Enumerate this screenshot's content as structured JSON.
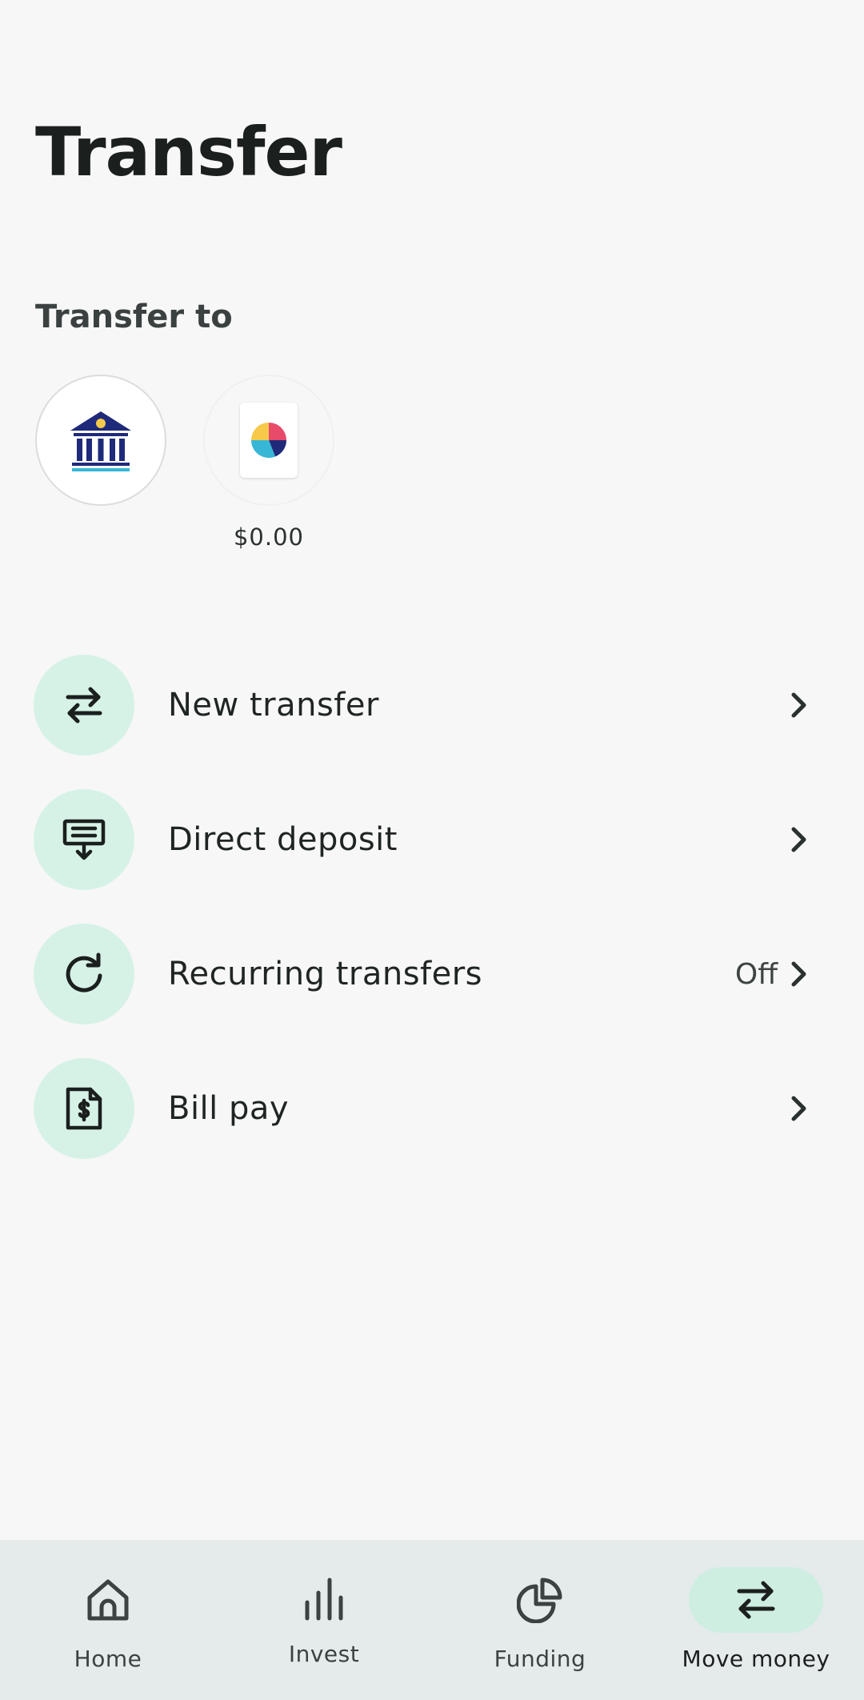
{
  "page": {
    "title": "Transfer"
  },
  "transfer_to": {
    "label": "Transfer to",
    "accounts": [
      {
        "icon": "bank-icon",
        "balance": ""
      },
      {
        "icon": "app-logo-icon",
        "balance": "$0.00"
      }
    ]
  },
  "menu": {
    "items": [
      {
        "label": "New transfer",
        "icon": "swap-arrows-icon",
        "status": ""
      },
      {
        "label": "Direct deposit",
        "icon": "deposit-icon",
        "status": ""
      },
      {
        "label": "Recurring transfers",
        "icon": "refresh-icon",
        "status": "Off"
      },
      {
        "label": "Bill pay",
        "icon": "dollar-document-icon",
        "status": ""
      }
    ]
  },
  "bottom_nav": {
    "items": [
      {
        "label": "Home",
        "icon": "home-icon",
        "active": false
      },
      {
        "label": "Invest",
        "icon": "bar-chart-icon",
        "active": false
      },
      {
        "label": "Funding",
        "icon": "pie-chart-icon",
        "active": false
      },
      {
        "label": "Move money",
        "icon": "swap-arrows-icon",
        "active": true
      }
    ]
  },
  "colors": {
    "background": "#f7f7f7",
    "icon_circle": "#d6f2e7",
    "nav_background": "#e5eaea",
    "nav_active_pill": "#cdeee0",
    "bank_blue": "#1f2a7a",
    "bank_cyan": "#37b6d6",
    "bank_dot": "#f6c94a"
  }
}
